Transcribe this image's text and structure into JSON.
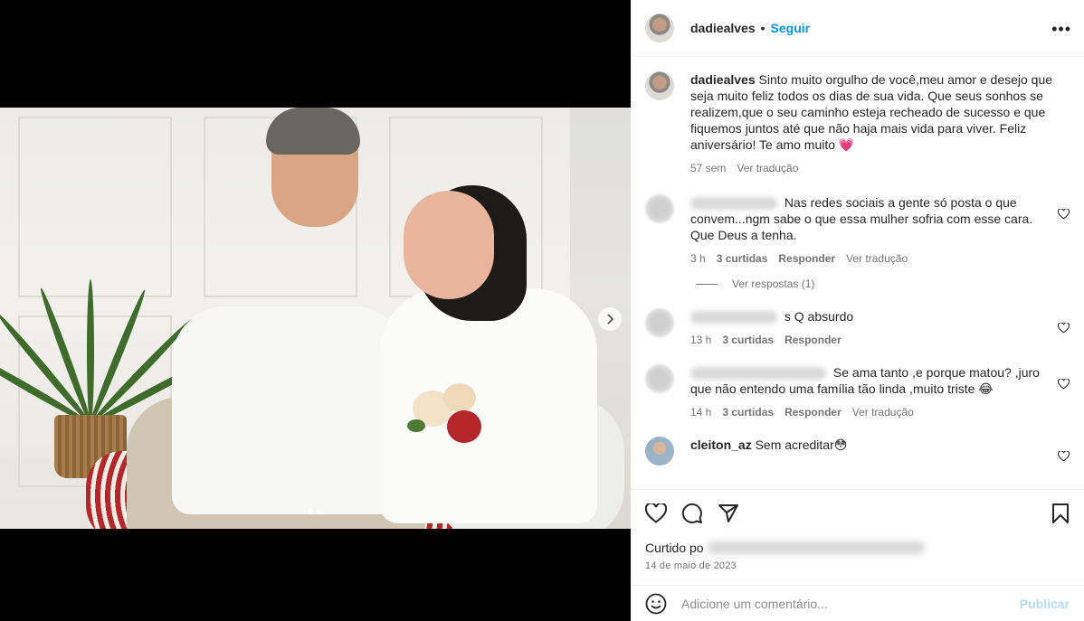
{
  "post": {
    "username": "dadiealves",
    "separator": "•",
    "follow_label": "Seguir",
    "more_icon": "more-horizontal-icon"
  },
  "caption": {
    "username": "dadiealves",
    "text": "Sinto muito orgulho de você,meu amor e desejo que seja muito feliz todos os dias de sua vida. Que seus sonhos se realizem,que o seu caminho esteja recheado de sucesso e que fiquemos juntos até que não haja mais vida para viver. Feliz aniversário! Te amo muito 💗",
    "time": "57 sem",
    "translate": "Ver tradução"
  },
  "comments": [
    {
      "text": "Nas redes sociais a gente só posta o que convem...ngm sabe o que essa mulher sofria com esse cara. Que Deus a tenha.",
      "time": "3 h",
      "likes": "3 curtidas",
      "reply": "Responder",
      "translate": "Ver tradução"
    },
    {
      "text": "s Q absurdo",
      "time": "13 h",
      "likes": "3 curtidas",
      "reply": "Responder"
    },
    {
      "text": "Se ama tanto ,e porque matou? ,juro que não entendo uma família tão linda ,muito triste 😂",
      "time": "14 h",
      "likes": "3 curtidas",
      "reply": "Responder",
      "translate": "Ver tradução"
    },
    {
      "username": "cleiton_az",
      "text": "Sem acreditar😳"
    }
  ],
  "view_replies": "Ver respostas (1)",
  "actions": {
    "like_icon": "heart-icon",
    "comment_icon": "comment-icon",
    "share_icon": "send-icon",
    "save_icon": "bookmark-icon"
  },
  "likes_label": "Curtido po",
  "date": "14 de maio de 2023",
  "add_comment": {
    "placeholder": "Adicione um comentário...",
    "publish": "Publicar",
    "emoji_icon": "emoji-icon"
  },
  "colors": {
    "follow": "#0095f6",
    "publish_disabled": "#b3dbff",
    "muted": "#737373"
  }
}
